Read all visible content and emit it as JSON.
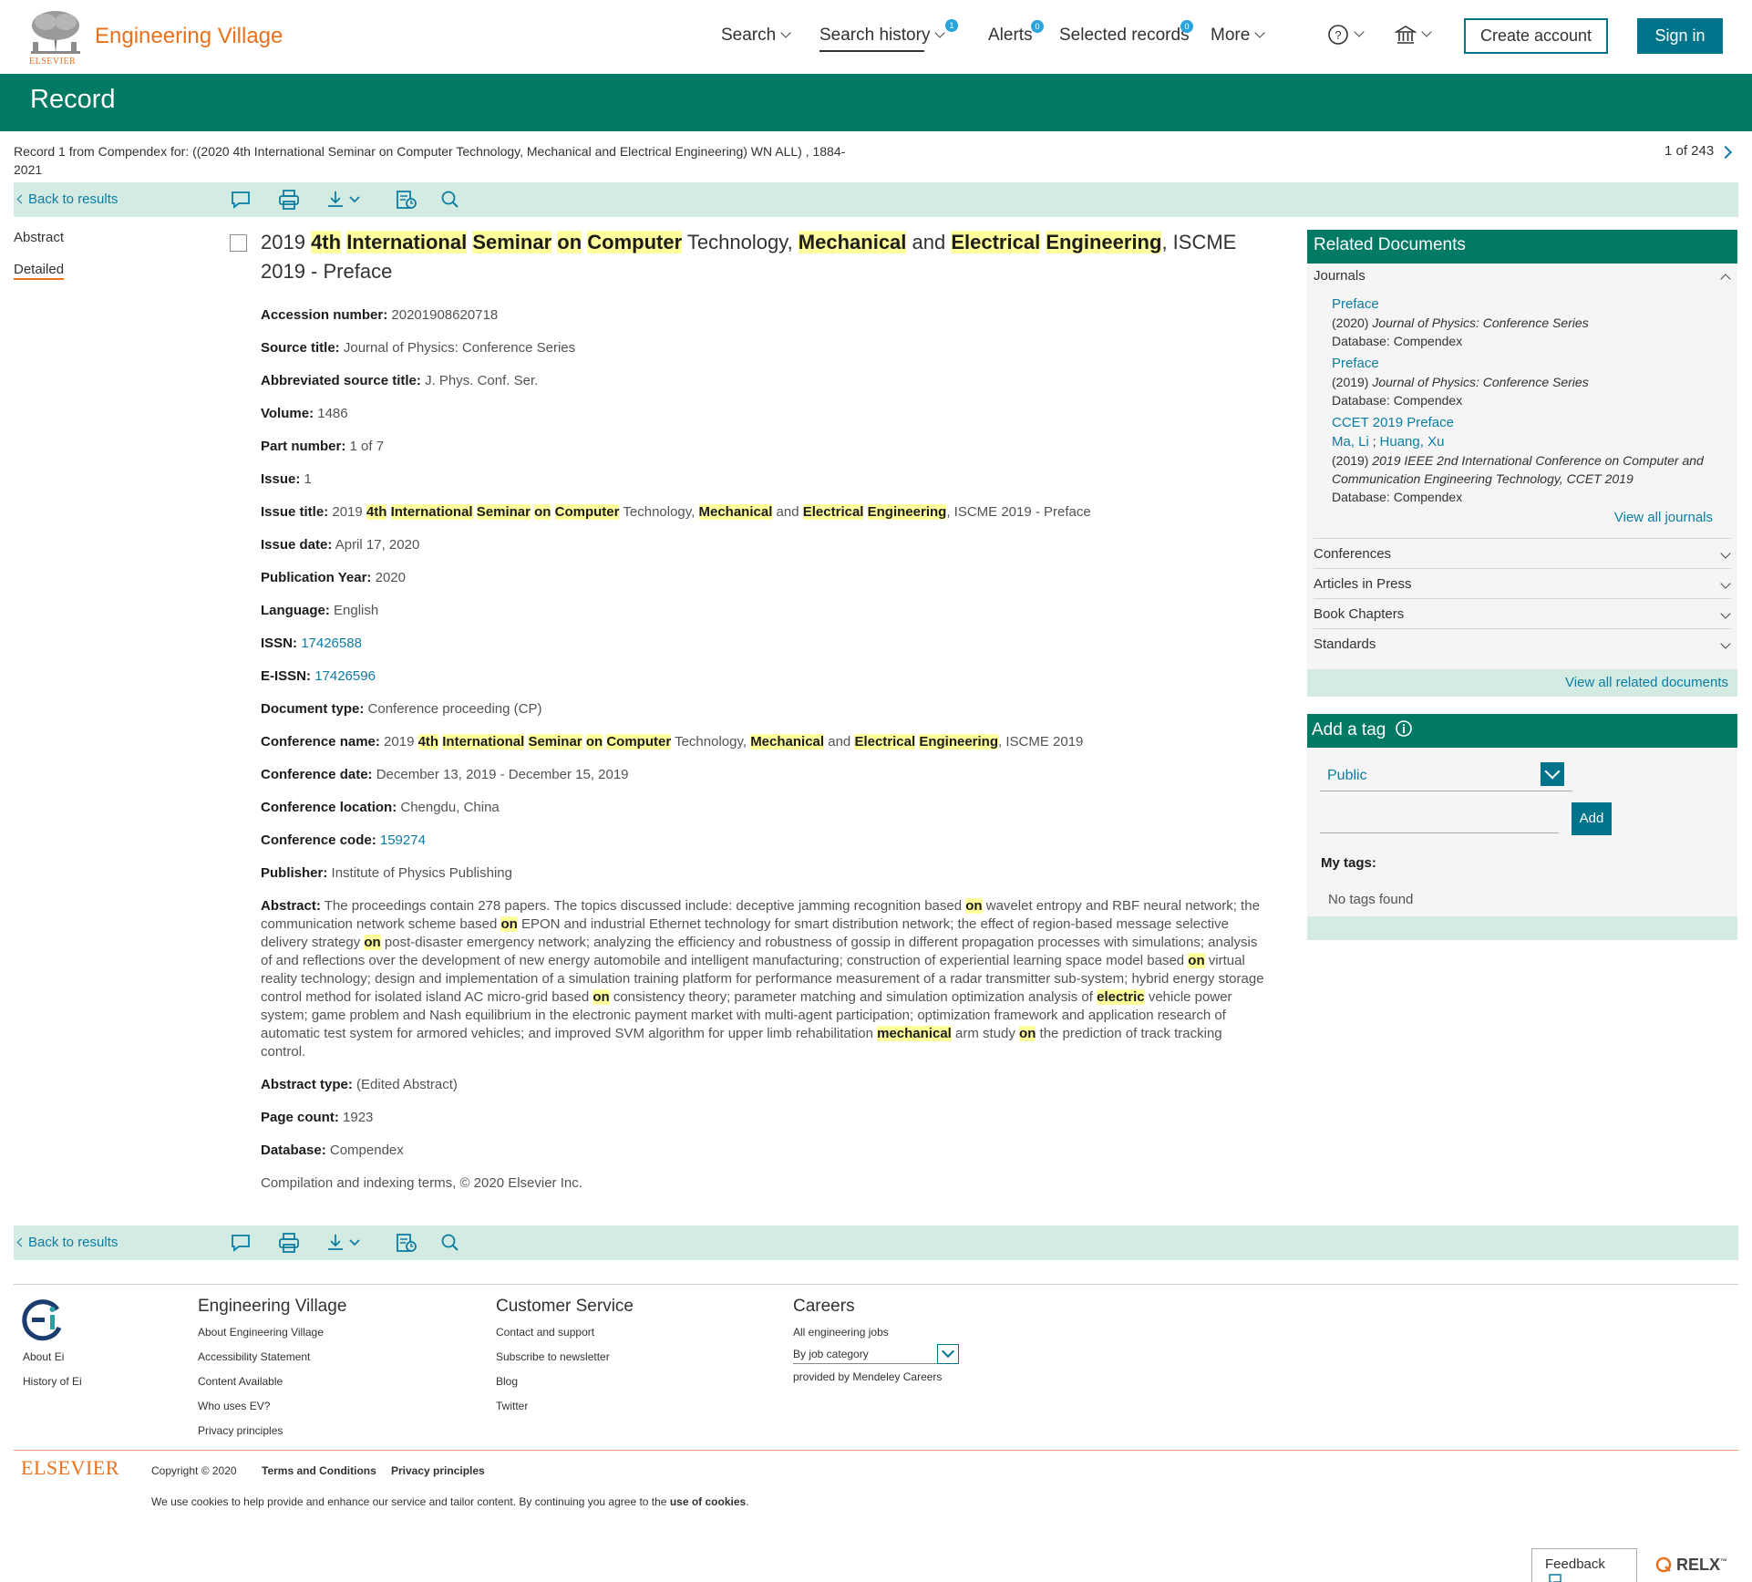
{
  "header": {
    "brand": "Engineering Village",
    "publisher_small": "ELSEVIER",
    "nav": {
      "search": "Search",
      "search_history": "Search history",
      "search_history_count": "1",
      "alerts": "Alerts",
      "alerts_count": "0",
      "selected_records": "Selected records",
      "selected_records_count": "0",
      "more": "More"
    },
    "create_account": "Create account",
    "sign_in": "Sign in"
  },
  "page_title": "Record",
  "breadcrumb": "Record 1 from Compendex for: ((2020 4th International Seminar on Computer Technology, Mechanical and Electrical Engineering) WN ALL) , 1884-2021",
  "pager": "1 of 243",
  "toolbar": {
    "back": "Back to results"
  },
  "leftnav": {
    "abstract": "Abstract",
    "detailed": "Detailed"
  },
  "record": {
    "title_parts": [
      "2019 ",
      "4th",
      " ",
      "International",
      " ",
      "Seminar",
      " ",
      "on",
      " ",
      "Computer",
      " Technology, ",
      "Mechanical",
      " and ",
      "Electrical",
      " ",
      "Engineering",
      ", ISCME 2019 - Preface"
    ],
    "fields": {
      "accession_label": "Accession number:",
      "accession": "20201908620718",
      "source_label": "Source title:",
      "source": "Journal of Physics: Conference Series",
      "abbrev_label": "Abbreviated source title:",
      "abbrev": "J. Phys. Conf. Ser.",
      "volume_label": "Volume:",
      "volume": "1486",
      "part_label": "Part number:",
      "part": "1 of 7",
      "issue_label": "Issue:",
      "issue": "1",
      "issue_title_label": "Issue title:",
      "issue_date_label": "Issue date:",
      "issue_date": "April 17, 2020",
      "pub_year_label": "Publication Year:",
      "pub_year": "2020",
      "language_label": "Language:",
      "language": "English",
      "issn_label": "ISSN:",
      "issn": "17426588",
      "eissn_label": "E-ISSN:",
      "eissn": "17426596",
      "doctype_label": "Document type:",
      "doctype": "Conference proceeding (CP)",
      "conf_name_label": "Conference name:",
      "conf_date_label": "Conference date:",
      "conf_date": "December 13, 2019 - December 15, 2019",
      "conf_loc_label": "Conference location:",
      "conf_loc": "Chengdu, China",
      "conf_code_label": "Conference code:",
      "conf_code": "159274",
      "publisher_label": "Publisher:",
      "publisher": "Institute of Physics Publishing",
      "abstract_label": "Abstract:",
      "abstract_type_label": "Abstract type:",
      "abstract_type": "(Edited Abstract)",
      "page_count_label": "Page count:",
      "page_count": "1923",
      "database_label": "Database:",
      "database": "Compendex",
      "copyright": "Compilation and indexing terms, © 2020 Elsevier Inc."
    },
    "issue_title_parts": [
      "2019 ",
      "4th",
      " ",
      "International",
      " ",
      "Seminar",
      " ",
      "on",
      " ",
      "Computer",
      " Technology, ",
      "Mechanical",
      " and ",
      "Electrical",
      " ",
      "Engineering",
      ", ISCME 2019 - Preface"
    ],
    "conf_name_parts": [
      "2019 ",
      "4th",
      " ",
      "International",
      " ",
      "Seminar",
      " ",
      "on",
      " ",
      "Computer",
      " Technology, ",
      "Mechanical",
      " and ",
      "Electrical",
      " ",
      "Engineering",
      ", ISCME 2019"
    ],
    "abstract_parts": [
      "The proceedings contain 278 papers. The topics discussed include: deceptive jamming recognition based ",
      "on",
      " wavelet entropy and RBF neural network; the communication network scheme based ",
      "on",
      " EPON and industrial Ethernet technology for smart distribution network; the effect of region-based message selective delivery strategy ",
      "on",
      " post-disaster emergency network; analyzing the efficiency and robustness of gossip in different propagation processes with simulations; analysis of and reflections over the development of new energy automobile and intelligent manufacturing; construction of experiential learning space model based ",
      "on",
      " virtual reality technology; design and implementation of a simulation training platform for performance measurement of a radar transmitter sub-system; hybrid energy storage control method for isolated island AC micro-grid based ",
      "on",
      " consistency theory; parameter matching and simulation optimization analysis of ",
      "electric",
      " vehicle power system; game problem and Nash equilibrium in the electronic payment market with multi-agent participation; optimization framework and application research of automatic test system for armored vehicles; and improved SVM algorithm for upper limb rehabilitation ",
      "mechanical",
      " arm study ",
      "on",
      " the prediction of track tracking control."
    ]
  },
  "related": {
    "heading": "Related Documents",
    "journals_label": "Journals",
    "items": [
      {
        "title": "Preface",
        "year": "(2020)",
        "source": "Journal of Physics: Conference Series",
        "database": "Database: Compendex"
      },
      {
        "title": "Preface",
        "year": "(2019)",
        "source": "Journal of Physics: Conference Series",
        "database": "Database: Compendex"
      },
      {
        "title": "CCET 2019 Preface",
        "author1": "Ma, Li",
        "author2": "Huang, Xu",
        "year": "(2019)",
        "source": "2019 IEEE 2nd International Conference on Computer and Communication Engineering Technology, CCET 2019",
        "database": "Database: Compendex"
      }
    ],
    "view_all_journals": "View all journals",
    "conferences": "Conferences",
    "articles_in_press": "Articles in Press",
    "book_chapters": "Book Chapters",
    "standards": "Standards",
    "view_all_related": "View all related documents"
  },
  "tags": {
    "heading": "Add a tag",
    "visibility": "Public",
    "add": "Add",
    "my_tags": "My tags:",
    "none": "No tags found"
  },
  "footer": {
    "col_ei": {
      "about": "About Ei",
      "history": "History of Ei"
    },
    "col_ev": {
      "heading": "Engineering Village",
      "items": [
        "About Engineering Village",
        "Accessibility Statement",
        "Content Available",
        "Who uses EV?",
        "Privacy principles"
      ]
    },
    "col_cs": {
      "heading": "Customer Service",
      "items": [
        "Contact and support",
        "Subscribe to newsletter",
        "Blog",
        "Twitter"
      ]
    },
    "col_careers": {
      "heading": "Careers",
      "all_jobs": "All engineering jobs",
      "job_category": "By job category",
      "provided": "provided by Mendeley Careers"
    },
    "elsevier": "ELSEVIER",
    "copyright": "Copyright © 2020",
    "terms": "Terms and Conditions",
    "privacy": "Privacy principles",
    "cookies_text": "We use cookies to help provide and enhance our service and tailor content. By continuing you agree to the ",
    "cookies_link": "use of cookies",
    "feedback": "Feedback",
    "relx": "RELX"
  }
}
